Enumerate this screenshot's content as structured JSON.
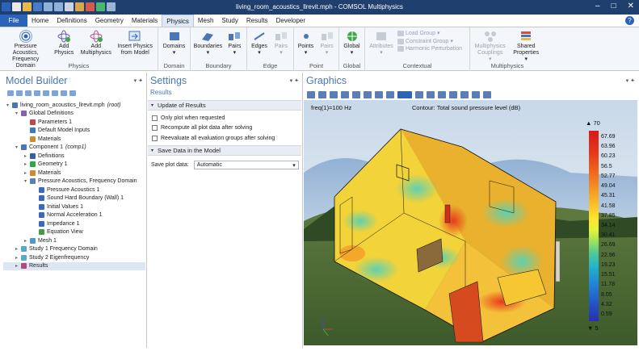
{
  "window": {
    "title": "living_room_acoustics_llrevit.mph - COMSOL Multiphysics"
  },
  "ribbon_tabs": [
    "Home",
    "Definitions",
    "Geometry",
    "Materials",
    "Physics",
    "Mesh",
    "Study",
    "Results",
    "Developer"
  ],
  "file_tab": "File",
  "active_tab": "Physics",
  "ribbon": {
    "physics_group": {
      "label": "Physics",
      "buttons": [
        "Pressure Acoustics, Frequency Domain",
        "Add Physics",
        "Add Multiphysics",
        "Insert Physics from Model"
      ]
    },
    "domain_group": {
      "label": "Domain",
      "buttons": [
        "Domains"
      ]
    },
    "boundary_group": {
      "label": "Boundary",
      "buttons": [
        "Boundaries",
        "Pairs"
      ]
    },
    "edge_group": {
      "label": "Edge",
      "buttons": [
        "Edges",
        "Pairs"
      ]
    },
    "point_group": {
      "label": "Point",
      "buttons": [
        "Points",
        "Pairs"
      ]
    },
    "global_group": {
      "label": "Global",
      "buttons": [
        "Global"
      ]
    },
    "contextual_group": {
      "label": "Contextual",
      "buttons": [
        "Attributes",
        "Load Group",
        "Constraint Group",
        "Harmonic Perturbation"
      ]
    },
    "multiphysics_group": {
      "label": "Multiphysics",
      "buttons": [
        "Multiphysics Couplings",
        "Shared Properties"
      ]
    }
  },
  "model_builder": {
    "title": "Model Builder",
    "tree": [
      {
        "label": "living_room_acoustics_llrevit.mph",
        "tag": "(root)",
        "level": 0,
        "icon": "#4a76b8",
        "arrow": "▾"
      },
      {
        "label": "Global Definitions",
        "level": 1,
        "icon": "#8a5fb0",
        "arrow": "▾"
      },
      {
        "label": "Parameters 1",
        "level": 2,
        "icon": "#c04848",
        "arrow": ""
      },
      {
        "label": "Default Model Inputs",
        "level": 2,
        "icon": "#3a7cc0",
        "arrow": ""
      },
      {
        "label": "Materials",
        "level": 2,
        "icon": "#d08a2a",
        "arrow": ""
      },
      {
        "label": "Component 1",
        "tag": "(comp1)",
        "level": 1,
        "icon": "#4a76b8",
        "arrow": "▾"
      },
      {
        "label": "Definitions",
        "level": 2,
        "icon": "#3a5fa0",
        "arrow": "▸"
      },
      {
        "label": "Geometry 1",
        "level": 2,
        "icon": "#2aa84a",
        "arrow": "▸"
      },
      {
        "label": "Materials",
        "level": 2,
        "icon": "#d08a2a",
        "arrow": "▸"
      },
      {
        "label": "Pressure Acoustics, Frequency Domain",
        "level": 2,
        "icon": "#5b7fb8",
        "arrow": "▾"
      },
      {
        "label": "Pressure Acoustics 1",
        "level": 3,
        "icon": "#3a6ac0",
        "arrow": ""
      },
      {
        "label": "Sound Hard Boundary (Wall) 1",
        "level": 3,
        "icon": "#3a6ac0",
        "arrow": ""
      },
      {
        "label": "Initial Values 1",
        "level": 3,
        "icon": "#3a6ac0",
        "arrow": ""
      },
      {
        "label": "Normal Acceleration 1",
        "level": 3,
        "icon": "#3a6ac0",
        "arrow": ""
      },
      {
        "label": "Impedance 1",
        "level": 3,
        "icon": "#3a6ac0",
        "arrow": ""
      },
      {
        "label": "Equation View",
        "level": 3,
        "icon": "#4a9a4a",
        "arrow": ""
      },
      {
        "label": "Mesh 1",
        "level": 2,
        "icon": "#4a9ad0",
        "arrow": "▸"
      },
      {
        "label": "Study 1 Frequency Domain",
        "level": 1,
        "icon": "#5aa8d0",
        "arrow": "▸"
      },
      {
        "label": "Study 2 Eigenfrequency",
        "level": 1,
        "icon": "#5aa8d0",
        "arrow": "▸"
      },
      {
        "label": "Results",
        "level": 1,
        "icon": "#b04a7a",
        "arrow": "▸",
        "selected": true
      }
    ]
  },
  "settings": {
    "title": "Settings",
    "subtitle": "Results",
    "update_section": "Update of Results",
    "checkboxes": [
      "Only plot when requested",
      "Recompute all plot data after solving",
      "Reevaluate all evaluation groups after solving"
    ],
    "save_section": "Save Data in the Model",
    "save_plot_label": "Save plot data:",
    "save_plot_value": "Automatic"
  },
  "graphics": {
    "title": "Graphics",
    "freq_label": "freq(1)=100 Hz",
    "plot_title": "Contour: Total sound pressure level (dB)",
    "colorbar": {
      "max": "70",
      "min": "5",
      "ticks": [
        "67.69",
        "63.96",
        "60.23",
        "56.5",
        "52.77",
        "49.04",
        "45.31",
        "41.58",
        "37.85",
        "34.14",
        "30.41",
        "26.69",
        "22.96",
        "19.23",
        "15.51",
        "11.78",
        "8.05",
        "4.32",
        "0.59"
      ]
    }
  }
}
